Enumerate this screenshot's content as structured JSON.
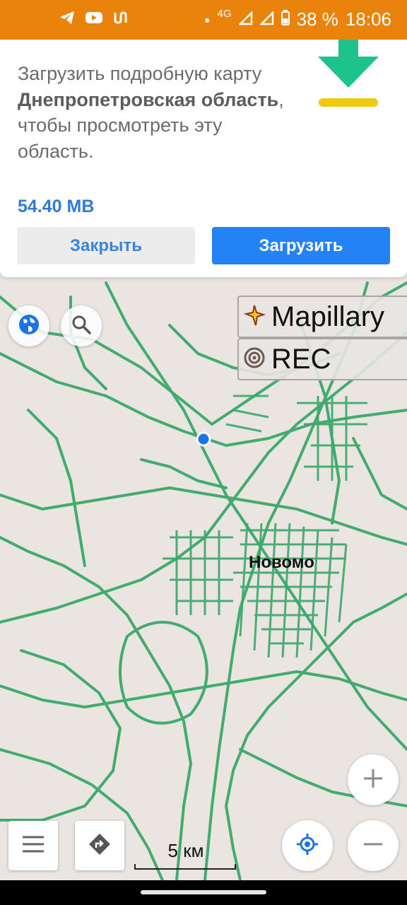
{
  "status_bar": {
    "battery": "38 %",
    "time": "18:06",
    "network": "4G",
    "icons": [
      "telegram-icon",
      "youtube-icon",
      "app-icon",
      "dot-icon",
      "signal-icon",
      "signal-icon-2",
      "battery-icon"
    ]
  },
  "banner": {
    "msg_prefix": "Загрузить подробную карту ",
    "region": "Днепропетровская область",
    "msg_suffix": ", чтобы просмотреть эту область.",
    "size": "54.40 MB",
    "close_label": "Закрыть",
    "download_label": "Загрузить",
    "icon": "download-arrow-icon"
  },
  "map": {
    "layers": [
      {
        "label": "Mapillary",
        "icon": "mapillary-icon"
      },
      {
        "label": "REC",
        "icon": "record-icon"
      }
    ],
    "place_label": "Новомо",
    "scale_label": "5 км",
    "road_color": "#3aa86a",
    "background_color": "#ebe5e2",
    "location_color": "#1a73e8"
  },
  "controls": {
    "globe": "globe-icon",
    "search": "search-icon",
    "menu": "menu-icon",
    "directions": "directions-icon",
    "my_location": "my-location-icon",
    "zoom_in": "plus-icon",
    "zoom_out": "minus-icon"
  },
  "colors": {
    "status_bar": "#e9830b",
    "accent_blue": "#2383f6",
    "download_green": "#1dc38a",
    "download_yellow": "#f2c811"
  }
}
